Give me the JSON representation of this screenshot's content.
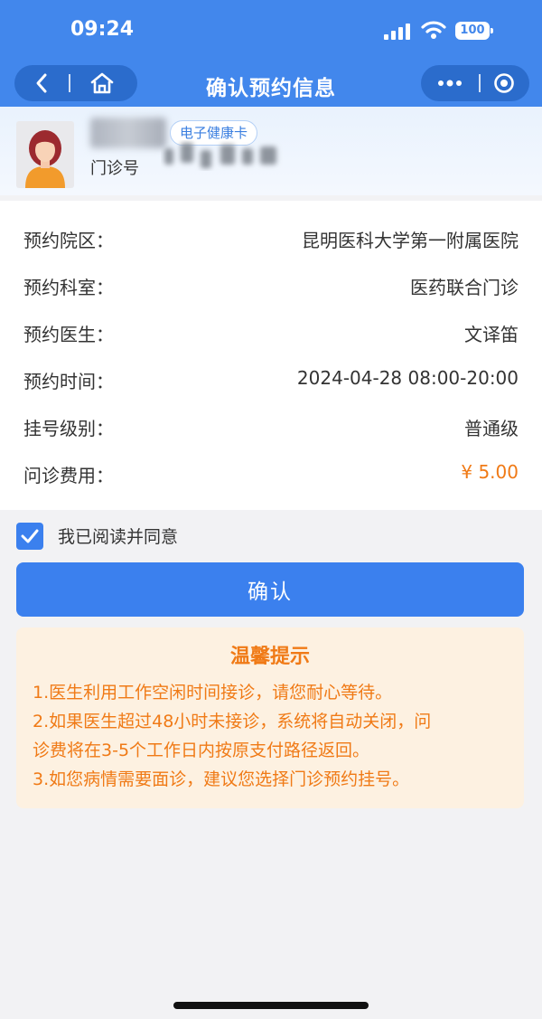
{
  "status_bar": {
    "time": "09:24",
    "battery": "100"
  },
  "nav": {
    "title": "确认预约信息"
  },
  "patient": {
    "badge": "电子健康卡",
    "mz_label": "门诊号"
  },
  "appointment": [
    {
      "label": "预约院区：",
      "value": "昆明医科大学第一附属医院"
    },
    {
      "label": "预约科室：",
      "value": "医药联合门诊"
    },
    {
      "label": "预约医生：",
      "value": "文译笛"
    },
    {
      "label": "预约时间：",
      "value": "2024-04-28 08:00-20:00"
    },
    {
      "label": "挂号级别：",
      "value": "普通级"
    },
    {
      "label": "问诊费用：",
      "value": "¥ 5.00"
    }
  ],
  "agreement": {
    "checked": true,
    "text": "我已阅读并同意"
  },
  "confirm_button": "确认",
  "tips": {
    "title": "温馨提示",
    "lines": [
      "1.医生利用工作空闲时间接诊，请您耐心等待。",
      "2.如果医生超过48小时未接诊，系统将自动关闭，问",
      "诊费将在3-5个工作日内按原支付路径返回。",
      "3.如您病情需要面诊，建议您选择门诊预约挂号。"
    ]
  },
  "colors": {
    "primary": "#3b80ee",
    "accent": "#f07a16",
    "tips_bg": "#fdf1e1"
  }
}
